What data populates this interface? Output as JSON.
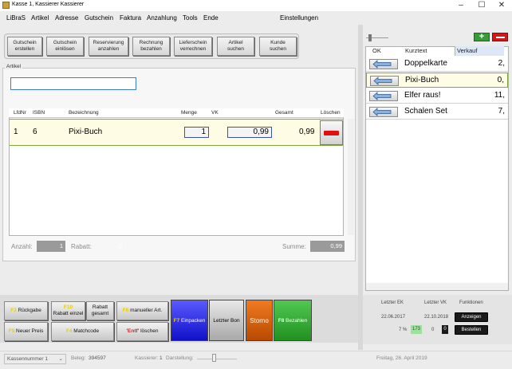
{
  "window": {
    "title": "Kasse 1, Kassierer Kassierer",
    "minimize": "–",
    "maximize": "☐",
    "close": "✕"
  },
  "menu": {
    "items": [
      "LiBraS",
      "Artikel",
      "Adresse",
      "Gutschein",
      "Faktura",
      "Anzahlung",
      "Tools",
      "Ende"
    ],
    "settings": "Einstellungen"
  },
  "toolbar": [
    {
      "label": "Gutschein\nerstellen"
    },
    {
      "label": "Gutschein\neinlösen"
    },
    {
      "label": "Reservierung\nanzahlen"
    },
    {
      "label": "Rechnung\nbezahlen"
    },
    {
      "label": "Lieferschein\nverrechnen"
    },
    {
      "label": "Artikel\nsuchen"
    },
    {
      "label": "Kunde\nsuchen"
    }
  ],
  "artikel": {
    "label": "Artikel",
    "input_value": ""
  },
  "table": {
    "headers": [
      "LfdNr",
      "ISBN",
      "Bezeichnung",
      "Menge",
      "VK",
      "Gesamt",
      "Löschen"
    ],
    "rows": [
      {
        "lfdnr": "1",
        "isbn": "6",
        "bezeichnung": "Pixi-Buch",
        "menge": "1",
        "vk": "0,99",
        "gesamt": "0,99"
      }
    ]
  },
  "footer": {
    "anzahl_label": "Anzahl:",
    "anzahl_value": "1",
    "rabatt_label": "Rabatt:",
    "rabatt_value": "0",
    "summe_label": "Summe:",
    "summe_value": "0,99"
  },
  "actions": {
    "rueckgabe_key": "F3",
    "rueckgabe": "Rückgabe",
    "rabatt_einzel_key": "F10",
    "rabatt_einzel": "Rabatt einzel",
    "rabatt_gesamt": "Rabatt\ngesamt",
    "manuell_key": "F6",
    "manuell": "manueller Art.",
    "neuer_preis_key": "F9",
    "neuer_preis": "Neuer Preis",
    "matchcode_key": "F4",
    "matchcode": "Matchcode",
    "entf_key": "'Entf'",
    "entf": "löschen",
    "einpacken_key": "F7",
    "einpacken": "Einpacken",
    "letzter_bon": "Letzter Bon",
    "storno": "Storno",
    "bezahlen_key": "F8",
    "bezahlen": "Bezahlen"
  },
  "status": {
    "kassennummer": "Kassennummer 1",
    "beleg_label": "Beleg:",
    "beleg_value": "394597",
    "kassierer_label": "Kassierer:",
    "kassierer_value": "1",
    "darstellung_label": "Darstellung:",
    "date": "Freitag, 26. April 2019"
  },
  "right": {
    "headers": [
      "OK",
      "Kurztext",
      "Verkauf"
    ],
    "plus": "+",
    "items": [
      {
        "name": "Doppelkarte",
        "price": "2,"
      },
      {
        "name": "Pixi-Buch",
        "price": "0,"
      },
      {
        "name": "Elfer raus!",
        "price": "11,"
      },
      {
        "name": "Schalen Set",
        "price": "7,"
      }
    ],
    "selected_index": 1,
    "info": {
      "letzter_ek_label": "Letzter EK",
      "letzter_vk_label": "Letzter VK",
      "funktionen_label": "Funktionen",
      "ek_date": "22.06.2017",
      "vk_date": "22.10.2018",
      "pct": "7 %",
      "val1": "173",
      "val2": "0",
      "val3": "0",
      "anzeigen": "Anzeigen",
      "bestellen": "Bestellen"
    }
  },
  "colors": {
    "accent_green": "#7da83a",
    "row_highlight": "#fefce4",
    "storno": "#d86010",
    "bezahlen": "#3aa83a",
    "einpacken": "#2a2ae0",
    "delete_red": "#e01010"
  }
}
